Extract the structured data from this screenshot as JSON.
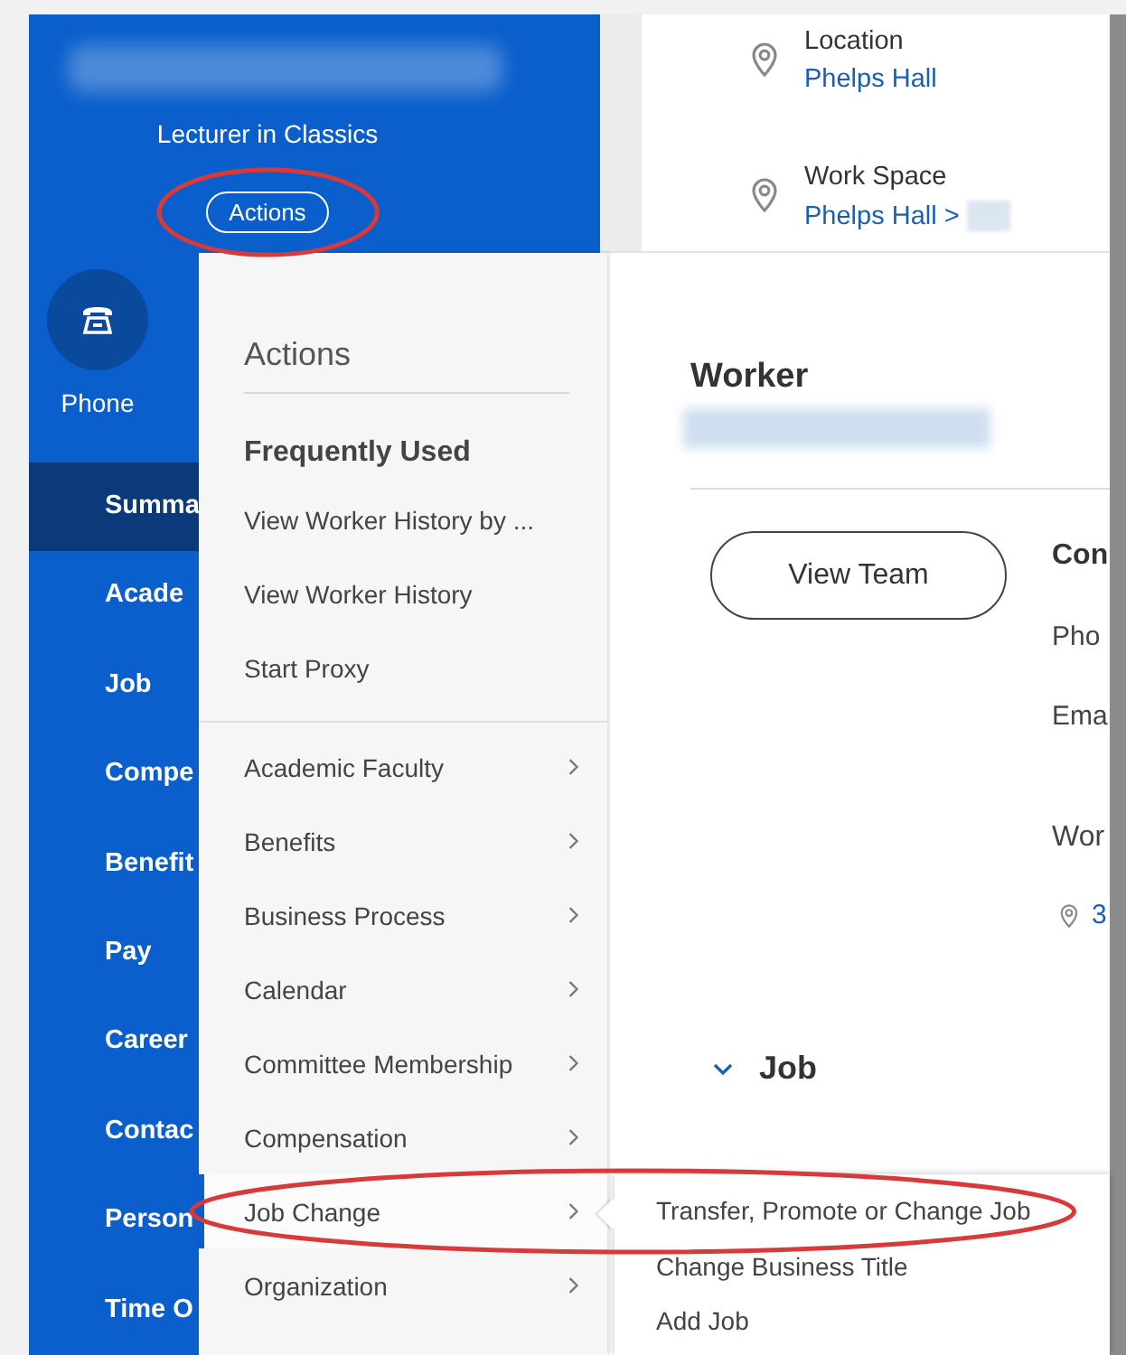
{
  "header": {
    "name_blurred": true,
    "job_title": "Lecturer in Classics",
    "actions_button": {
      "label": "Actions",
      "circled": true
    }
  },
  "quick_actions": [
    {
      "label": "Phone",
      "kind": "phone"
    }
  ],
  "nav": [
    {
      "label": "Summa",
      "selected": true
    },
    {
      "label": "Acade",
      "selected": false
    },
    {
      "label": "Job",
      "selected": false
    },
    {
      "label": "Compe",
      "selected": false
    },
    {
      "label": "Benefit",
      "selected": false
    },
    {
      "label": "Pay",
      "selected": false
    },
    {
      "label": "Career",
      "selected": false
    },
    {
      "label": "Contac",
      "selected": false
    },
    {
      "label": "Person",
      "selected": false
    },
    {
      "label": "Time O",
      "selected": false
    }
  ],
  "details": [
    {
      "label": "Location",
      "value": "Phelps Hall",
      "value_blurred": false
    },
    {
      "label": "Work Space",
      "value": "Phelps Hall >",
      "value_blurred": true
    }
  ],
  "worker_card": {
    "title": "Worker",
    "name_blurred": true,
    "button": "View Team",
    "contact": [
      {
        "text": "Con",
        "kind": "heading"
      },
      {
        "text": "Pho",
        "kind": "label"
      },
      {
        "text": "Ema",
        "kind": "label"
      },
      {
        "text": "Wor",
        "kind": "subheading"
      },
      {
        "text": "3",
        "kind": "location"
      }
    ]
  },
  "job_section": {
    "title": "Job",
    "expanded": true
  },
  "actions_menu": {
    "title": "Actions",
    "sections": [
      {
        "heading": "Frequently Used",
        "items": [
          {
            "label": "View Worker History by ...",
            "has_submenu": false,
            "selected": false,
            "circled": false
          },
          {
            "label": "View Worker History",
            "has_submenu": false,
            "selected": false,
            "circled": false
          },
          {
            "label": "Start Proxy",
            "has_submenu": false,
            "selected": false,
            "circled": false
          }
        ]
      },
      {
        "items": [
          {
            "label": "Academic Faculty",
            "has_submenu": true,
            "selected": false,
            "circled": false
          },
          {
            "label": "Benefits",
            "has_submenu": true,
            "selected": false,
            "circled": false
          },
          {
            "label": "Business Process",
            "has_submenu": true,
            "selected": false,
            "circled": false
          },
          {
            "label": "Calendar",
            "has_submenu": true,
            "selected": false,
            "circled": false
          },
          {
            "label": "Committee Membership",
            "has_submenu": true,
            "selected": false,
            "circled": false
          },
          {
            "label": "Compensation",
            "has_submenu": true,
            "selected": false,
            "circled": false
          },
          {
            "label": "Job Change",
            "has_submenu": true,
            "selected": true,
            "circled": true
          },
          {
            "label": "Organization",
            "has_submenu": true,
            "selected": false,
            "circled": false
          }
        ]
      }
    ]
  },
  "submenu": {
    "items": [
      {
        "label": "Transfer, Promote or Change Job"
      },
      {
        "label": "Change Business Title"
      },
      {
        "label": "Add Job"
      }
    ]
  }
}
